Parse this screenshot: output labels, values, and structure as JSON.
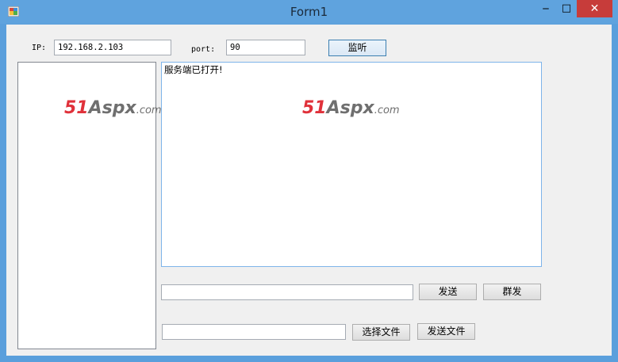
{
  "window": {
    "title": "Form1",
    "min_glyph": "‒",
    "max_glyph": "□",
    "close_glyph": "✕"
  },
  "form": {
    "ip_label": "IP:",
    "ip_value": "192.168.2.103",
    "port_label": "port:",
    "port_value": "90",
    "listen_button": "监听",
    "log_text": "服务端已打开!",
    "message_value": "",
    "send_button": "发送",
    "broadcast_button": "群发",
    "file_path_value": "",
    "choose_file_button": "选择文件",
    "send_file_button": "发送文件"
  },
  "watermark": {
    "number": "51",
    "brand": "Aspx",
    "suffix": ".com"
  },
  "colors": {
    "titlebar": "#5fa3de",
    "close": "#c73c3a",
    "client": "#f0f0f0",
    "watermark_red": "#e0313a"
  }
}
